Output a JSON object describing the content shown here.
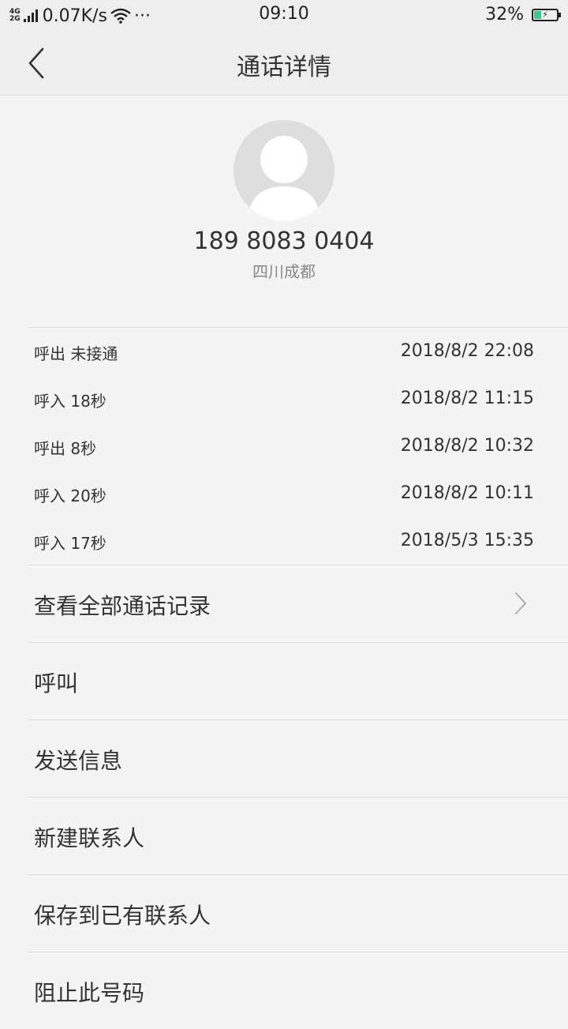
{
  "status_bar": {
    "net_4g": "4G",
    "net_2g": "2G",
    "speed": "0.07K/s",
    "more": "···",
    "time": "09:10",
    "battery": "32%",
    "battery_level": 0.32
  },
  "header": {
    "title": "通话详情"
  },
  "contact": {
    "number": "189 8083 0404",
    "location": "四川成都"
  },
  "calls": [
    {
      "type": "呼出  未接通",
      "time": "2018/8/2 22:08"
    },
    {
      "type": "呼入  18秒",
      "time": "2018/8/2 11:15"
    },
    {
      "type": "呼出  8秒",
      "time": "2018/8/2 10:32"
    },
    {
      "type": "呼入  20秒",
      "time": "2018/8/2 10:11"
    },
    {
      "type": "呼入  17秒",
      "time": "2018/5/3 15:35"
    }
  ],
  "actions": {
    "view_all": "查看全部通话记录",
    "call": "呼叫",
    "send_message": "发送信息",
    "new_contact": "新建联系人",
    "save_existing": "保存到已有联系人",
    "block": "阻止此号码"
  },
  "colors": {
    "background": "#f4f4f4",
    "header": "#eeeeee",
    "battery_fill": "#3cc88a",
    "avatar": "#dedede"
  }
}
